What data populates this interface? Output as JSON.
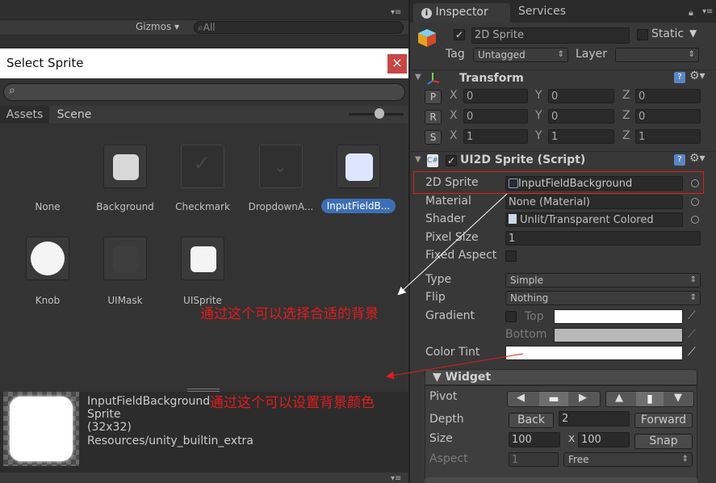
{
  "scene_toolbar": {
    "gizmos": "Gizmos",
    "search_placeholder": "All"
  },
  "sprite_dialog": {
    "title": "Select Sprite",
    "close": "×",
    "tabs": [
      "Assets",
      "Scene"
    ],
    "items": [
      "None",
      "Background",
      "Checkmark",
      "DropdownA...",
      "InputFieldB...",
      "Knob",
      "UIMask",
      "UISprite"
    ],
    "preview": {
      "name": "InputFieldBackground",
      "type": "Sprite",
      "size": "(32x32)",
      "path": "Resources/unity_builtin_extra"
    }
  },
  "inspector": {
    "tabs": [
      "Inspector",
      "Services"
    ],
    "object": {
      "enabled": "✓",
      "name": "2D Sprite",
      "static_label": "Static",
      "tag_label": "Tag",
      "tag_value": "Untagged",
      "layer_label": "Layer",
      "layer_value": ""
    },
    "transform": {
      "title": "Transform",
      "rows": [
        {
          "btn": "P",
          "x": "0",
          "y": "0",
          "z": "0"
        },
        {
          "btn": "R",
          "x": "0",
          "y": "0",
          "z": "0"
        },
        {
          "btn": "S",
          "x": "1",
          "y": "1",
          "z": "1"
        }
      ],
      "axis": [
        "X",
        "Y",
        "Z"
      ]
    },
    "ui2d": {
      "title": "UI2D Sprite (Script)",
      "sprite_label": "2D Sprite",
      "sprite_value": "InputFieldBackground",
      "material_label": "Material",
      "material_value": "None (Material)",
      "shader_label": "Shader",
      "shader_value": "Unlit/Transparent Colored",
      "pixel_label": "Pixel Size",
      "pixel_value": "1",
      "fixed_label": "Fixed Aspect",
      "type_label": "Type",
      "type_value": "Simple",
      "flip_label": "Flip",
      "flip_value": "Nothing",
      "gradient_label": "Gradient",
      "top_label": "Top",
      "bottom_label": "Bottom",
      "tint_label": "Color Tint"
    },
    "widget": {
      "title": "▼ Widget",
      "pivot_label": "Pivot",
      "depth_label": "Depth",
      "back": "Back",
      "depth_value": "2",
      "forward": "Forward",
      "size_label": "Size",
      "w": "100",
      "x_sep": "x",
      "h": "100",
      "snap": "Snap",
      "aspect_label": "Aspect",
      "aspect_value": "1",
      "aspect_mode": "Free"
    }
  },
  "annotations": {
    "choose_bg": "通过这个可以选择合适的背景",
    "set_color": "通过这个可以设置背景颜色"
  },
  "colors": {
    "highlight_red": "#e21c1c",
    "selected_blue": "#3d6fb6"
  }
}
